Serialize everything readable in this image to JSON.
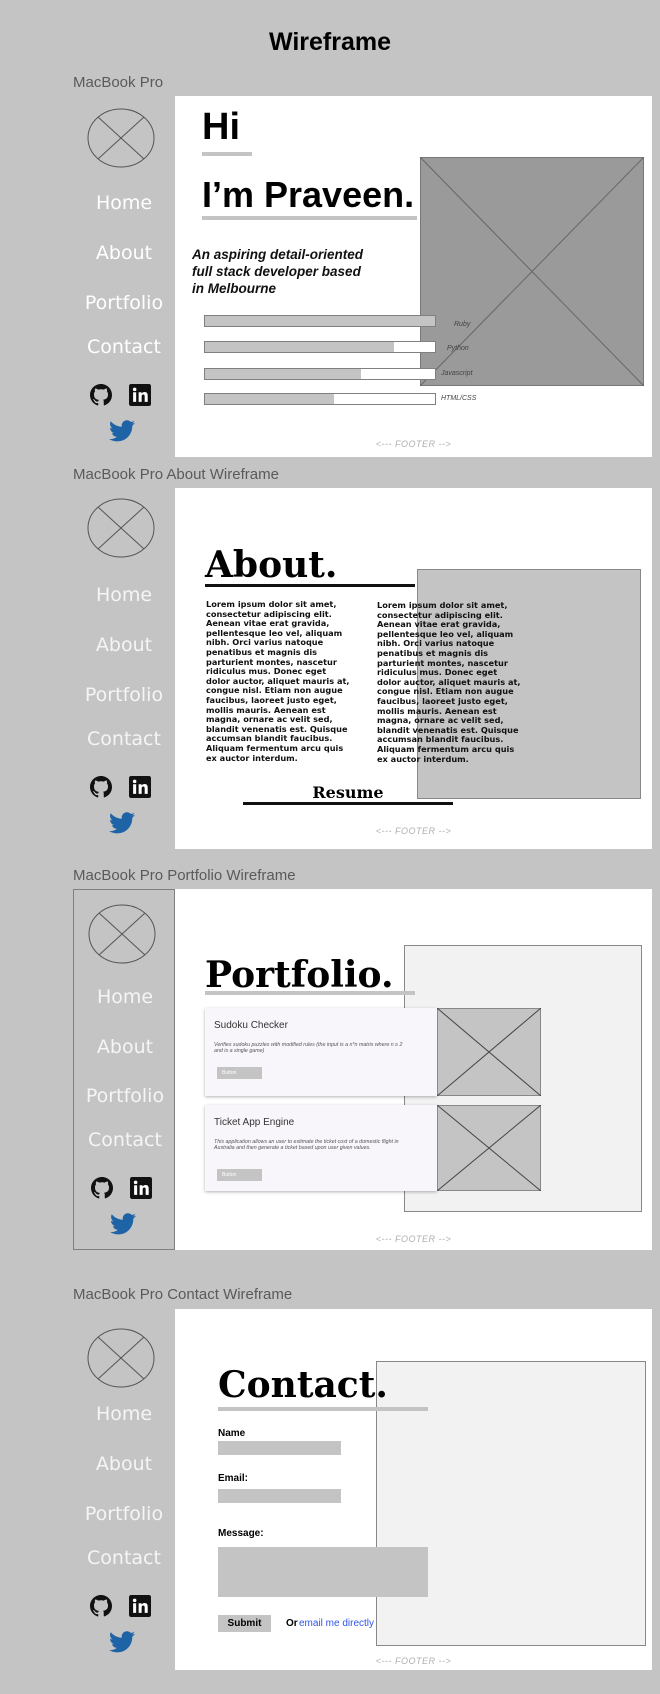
{
  "page_title": "Wireframe",
  "frames": {
    "home": {
      "label": "MacBook Pro"
    },
    "about": {
      "label": "MacBook Pro About Wireframe"
    },
    "portfolio": {
      "label": "MacBook Pro Portfolio Wireframe"
    },
    "contact": {
      "label": "MacBook Pro Contact Wireframe"
    }
  },
  "nav": {
    "home": "Home",
    "about": "About",
    "portfolio": "Portfolio",
    "contact": "Contact"
  },
  "icons": {
    "github": "github-icon",
    "linkedin": "linkedin-icon",
    "twitter": "twitter-icon",
    "avatar": "avatar-placeholder-icon"
  },
  "footer": "<--- FOOTER -->",
  "home": {
    "hi": "Hi",
    "name_line": "I’m Praveen.",
    "tagline": "An aspiring detail-oriented full stack developer based in Melbourne",
    "skills": [
      {
        "label": "Ruby",
        "level": 1.0
      },
      {
        "label": "Python",
        "level": 0.82
      },
      {
        "label": "Javascript",
        "level": 0.68
      },
      {
        "label": "HTML/CSS",
        "level": 0.56
      }
    ]
  },
  "about": {
    "heading": "About.",
    "lorem": "Lorem ipsum dolor sit amet, consectetur adipiscing elit. Aenean vitae erat gravida, pellentesque leo vel, aliquam nibh. Orci varius natoque penatibus et magnis dis parturient montes, nascetur ridiculus mus. Donec eget dolor auctor, aliquet mauris at, congue nisl. Etiam non augue faucibus, laoreet justo eget, mollis mauris. Aenean est magna, ornare ac velit sed, blandit venenatis est. Quisque accumsan blandit faucibus. Aliquam fermentum arcu quis ex auctor interdum.",
    "resume": "Resume"
  },
  "portfolio": {
    "heading": "Portfolio.",
    "cards": [
      {
        "title": "Sudoku Checker",
        "desc": "Verifies sudoku puzzles with modified rules (the input is a n*n matrix where n ≥ 2 and is a single game)",
        "button": "Button"
      },
      {
        "title": "Ticket App Engine",
        "desc": "This application allows an user to estimate the ticket cost of a domestic flight in Australia and then generate a ticket based upon user given values.",
        "button": "Button"
      }
    ]
  },
  "contact": {
    "heading": "Contact.",
    "name_label": "Name",
    "email_label": "Email:",
    "message_label": "Message:",
    "submit": "Submit",
    "or_text": "Or",
    "email_link": "email me directly"
  },
  "colors": {
    "background": "#c4c4c4",
    "placeholder": "#a0a0a0",
    "link": "#2f54eb",
    "panel": "#f2f2f2"
  }
}
